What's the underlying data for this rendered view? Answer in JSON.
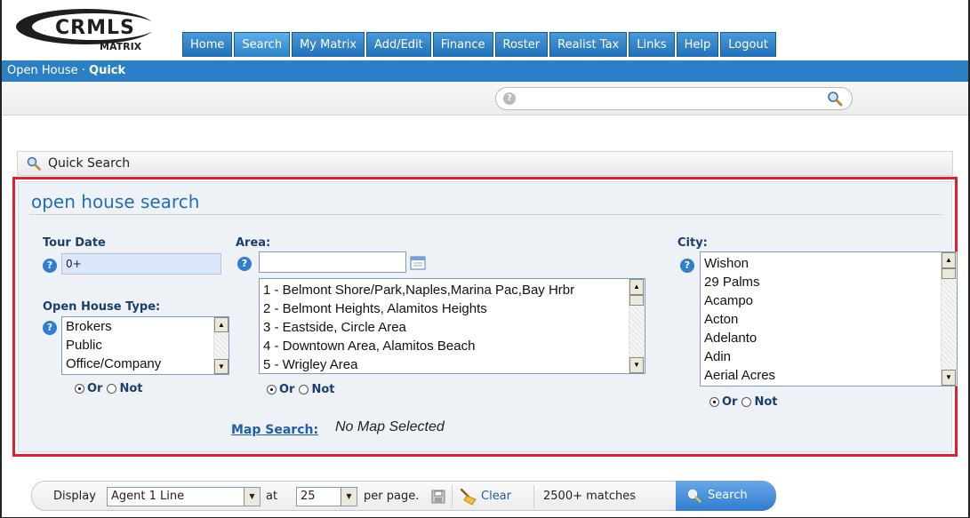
{
  "app": {
    "logo_text_top": "CRMLS",
    "logo_text_bottom": "MATRIX"
  },
  "nav": {
    "items": [
      {
        "label": "Home"
      },
      {
        "label": "Search",
        "active": true
      },
      {
        "label": "My Matrix"
      },
      {
        "label": "Add/Edit"
      },
      {
        "label": "Finance"
      },
      {
        "label": "Roster"
      },
      {
        "label": "Realist Tax"
      },
      {
        "label": "Links"
      },
      {
        "label": "Help"
      },
      {
        "label": "Logout"
      }
    ]
  },
  "breadcrumb": {
    "section": "Open House",
    "separator": "·",
    "current": "Quick"
  },
  "global_search": {
    "value": "",
    "placeholder": ""
  },
  "quick_search_bar": {
    "label": "Quick Search"
  },
  "form": {
    "title": "open house search",
    "tour_date": {
      "label": "Tour Date",
      "value": "0+"
    },
    "open_house_type": {
      "label": "Open House Type:",
      "options": [
        "Brokers",
        "Public",
        "Office/Company"
      ],
      "or_label": "Or",
      "not_label": "Not"
    },
    "area": {
      "label": "Area:",
      "input_value": "",
      "options": [
        "1 - Belmont Shore/Park,Naples,Marina Pac,Bay Hrbr",
        "2 - Belmont Heights, Alamitos Heights",
        "3 - Eastside, Circle Area",
        "4 - Downtown Area, Alamitos Beach",
        "5 - Wrigley Area"
      ],
      "or_label": "Or",
      "not_label": "Not"
    },
    "city": {
      "label": "City:",
      "options": [
        "Wishon",
        "29 Palms",
        "Acampo",
        "Acton",
        "Adelanto",
        "Adin",
        "Aerial Acres"
      ],
      "or_label": "Or",
      "not_label": "Not"
    },
    "map": {
      "link_label": "Map Search:",
      "status": "No Map Selected"
    }
  },
  "toolbar": {
    "display_label": "Display",
    "display_value": "Agent 1 Line",
    "at_label": "at",
    "per_page_value": "25",
    "per_page_label": "per page.",
    "clear_label": "Clear",
    "matches": "2500+ matches",
    "search_label": "Search"
  },
  "colors": {
    "accent": "#1f70b8",
    "highlight_border": "#e1202a",
    "panel_bg": "#eef1f6"
  }
}
